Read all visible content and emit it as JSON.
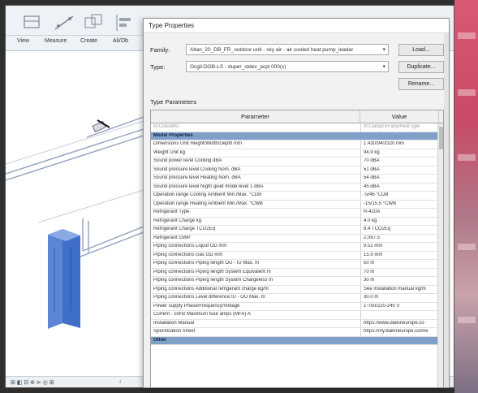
{
  "ribbon": {
    "labels": [
      "View",
      "Measure",
      "Create",
      "Ali/Ob"
    ]
  },
  "statusbar": {
    "icons_text": "⊞ ◧ ⊟ ⊕ ⊳ ◎ ⊞",
    "arrow": "‹"
  },
  "dialog": {
    "title": "Type Properties",
    "family_label": "Family:",
    "family_value": "Altan_20_DB_FR_outdoor unit - sky air - air cooled heat pump_leader",
    "type_label": "Type:",
    "type_value": "Ocgil-DOB-LS - duper_stdev_pcpi 000(s)",
    "load_button": "Load...",
    "duplicate_button": "Duplicate...",
    "rename_button": "Rename...",
    "type_parameters_label": "Type Parameters",
    "col_parameter": "Parameter",
    "col_value": "Value",
    "rows": [
      {
        "p": "M:ClassMsi",
        "v": "Ifl:ClaSpcSFanyrheelType",
        "kind": "greyed"
      },
      {
        "p": "Model Properties",
        "v": "",
        "kind": "group"
      },
      {
        "p": "Dimensions Unit Height/Width/Depth mm",
        "v": "1.430/940/320 mm",
        "kind": ""
      },
      {
        "p": "Weight Unit kg",
        "v": "94.9 kg",
        "kind": ""
      },
      {
        "p": "Sound power level Cooling dBA",
        "v": "70 dBA",
        "kind": ""
      },
      {
        "p": "Sound pressure level Cooling Nom. dBA",
        "v": "51 dBA",
        "kind": ""
      },
      {
        "p": "Sound pressure level Heating Nom. dBA",
        "v": "54 dBA",
        "kind": ""
      },
      {
        "p": "Sound pressure level Night quiet mode level 1 dBA",
        "v": "45 dBA",
        "kind": ""
      },
      {
        "p": "Operation range Cooling Ambient Min./Max. °CDB",
        "v": "-5/46 °CDB",
        "kind": ""
      },
      {
        "p": "Operation range Heating Ambient Min./Max. °CWB",
        "v": "-15/15.5 °CWB",
        "kind": ""
      },
      {
        "p": "Refrigerant Type",
        "v": "R-410A",
        "kind": ""
      },
      {
        "p": "Refrigerant Charge kg",
        "v": "4.0 kg",
        "kind": ""
      },
      {
        "p": "Refrigerant Charge TCO2Eq",
        "v": "8.4 TCO2Eq",
        "kind": ""
      },
      {
        "p": "Refrigerant GWP",
        "v": "2,087.5",
        "kind": ""
      },
      {
        "p": "Piping connections Liquid OD mm",
        "v": "9.52 mm",
        "kind": ""
      },
      {
        "p": "Piping connections Gas OD mm",
        "v": "15.9 mm",
        "kind": ""
      },
      {
        "p": "Piping connections Piping length OU - IU Max. m",
        "v": "50 m",
        "kind": ""
      },
      {
        "p": "Piping connections Piping length System Equivalent m",
        "v": "70 m",
        "kind": ""
      },
      {
        "p": "Piping connections Piping length System Chargeless m",
        "v": "30 m",
        "kind": ""
      },
      {
        "p": "Piping connections Additional refrigerant charge kg/m",
        "v": "See installation manual kg/m",
        "kind": ""
      },
      {
        "p": "Piping connections Level difference IU - OU Max. m",
        "v": "30.0 m",
        "kind": ""
      },
      {
        "p": "Power supply Phase/Frequency/Voltage",
        "v": "1~/50/220-240 V",
        "kind": ""
      },
      {
        "p": "Current - 50Hz Maximum fuse amps (MFA) A",
        "v": "",
        "kind": ""
      },
      {
        "p": "Installation Manual",
        "v": "https://www.daikineurope.co",
        "kind": ""
      },
      {
        "p": "Specification Sheet",
        "v": "https://my.daikineurope.com/e",
        "kind": ""
      },
      {
        "p": "Other",
        "v": "",
        "kind": "group"
      }
    ]
  },
  "colors": {
    "group_row": "#7fa0c8",
    "unit_blue": "#3f6fc9",
    "render_pink": "#d95a72"
  }
}
